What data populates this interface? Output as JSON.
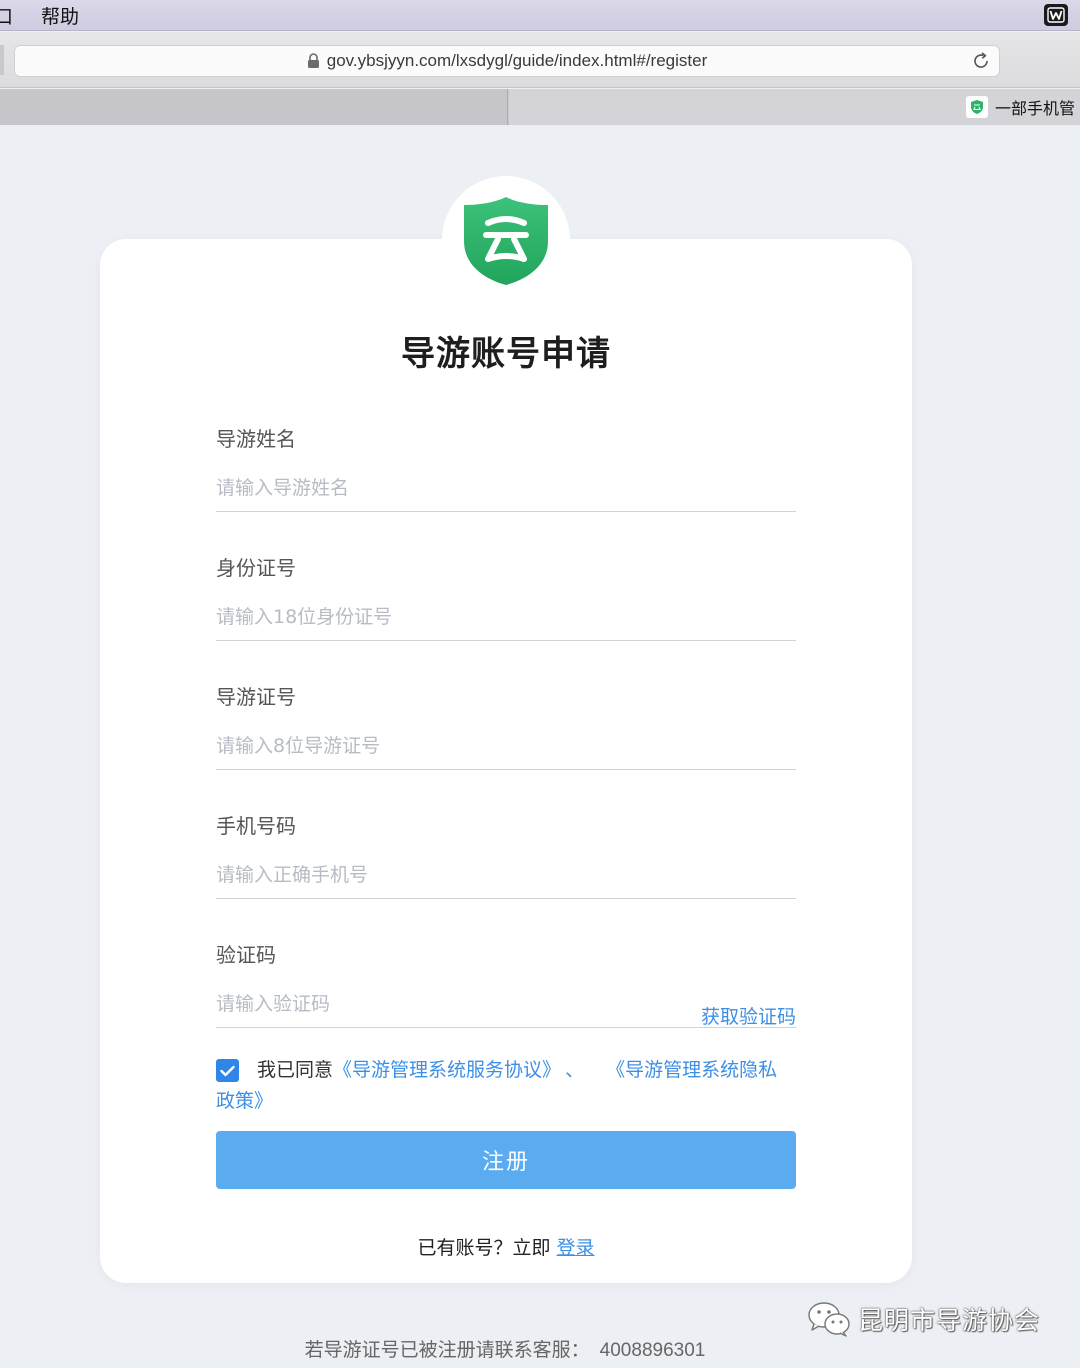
{
  "menubar": {
    "cut_item": "口",
    "help": "帮助",
    "right_icon": "wps-icon"
  },
  "browser": {
    "url": "gov.ybsjyyn.com/lxsdygl/guide/index.html#/register",
    "tab_title": "一部手机管"
  },
  "page": {
    "title": "导游账号申请",
    "fields": [
      {
        "label": "导游姓名",
        "placeholder": "请输入导游姓名",
        "value": ""
      },
      {
        "label": "身份证号",
        "placeholder": "请输入18位身份证号",
        "value": ""
      },
      {
        "label": "导游证号",
        "placeholder": "请输入8位导游证号",
        "value": ""
      },
      {
        "label": "手机号码",
        "placeholder": "请输入正确手机号",
        "value": ""
      },
      {
        "label": "验证码",
        "placeholder": "请输入验证码",
        "value": ""
      }
    ],
    "get_code": "获取验证码",
    "agreement": {
      "prefix": "我已同意",
      "link1": "《导游管理系统服务协议》",
      "sep": "、",
      "link2_part1": "《导游管理系统隐私",
      "link2_part2": "政策》",
      "checked": true
    },
    "register": "注册",
    "login_prompt": "已有账号？立即",
    "login_link": "登录",
    "footer_text": "若导游证号已被注册请联系客服：",
    "footer_phone": "4008896301"
  },
  "watermark": {
    "text": "昆明市导游协会"
  },
  "colors": {
    "accent": "#3d8fe6",
    "button": "#5aabf0",
    "logo_green": "#2fb26a",
    "background": "#eceff3"
  }
}
